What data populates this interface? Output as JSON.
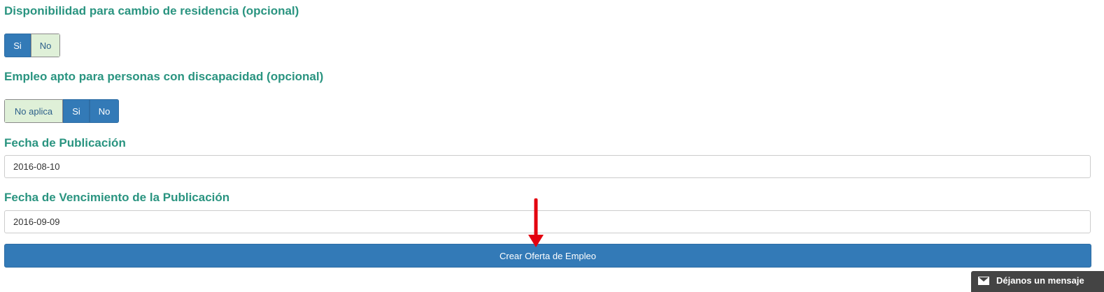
{
  "relocation": {
    "label": "Disponibilidad para cambio de residencia (opcional)",
    "options": [
      "Si",
      "No"
    ],
    "selected": "Si"
  },
  "disability": {
    "label": "Empleo apto para personas con discapacidad (opcional)",
    "options": [
      "No aplica",
      "Si",
      "No"
    ],
    "selected": "No aplica"
  },
  "publication_date": {
    "label": "Fecha de Publicación",
    "value": "2016-08-10"
  },
  "expiration_date": {
    "label": "Fecha de Vencimiento de la Publicación",
    "value": "2016-09-09"
  },
  "submit_label": "Crear Oferta de Empleo",
  "chat": {
    "label": "Déjanos un mensaje"
  },
  "colors": {
    "label": "#2a9480",
    "primary": "#337ab7",
    "toggle_off": "#dff0d8",
    "arrow": "#e3000f",
    "chat_bg": "#444444"
  },
  "icons": {
    "annotation": "red-arrow-down-icon",
    "chat": "envelope-icon"
  }
}
